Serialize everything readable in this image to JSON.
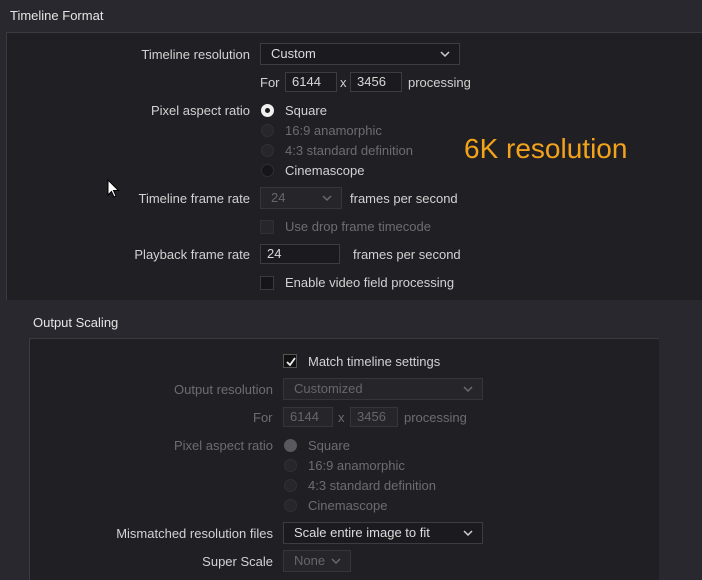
{
  "timeline_format": {
    "title": "Timeline Format",
    "resolution_label": "Timeline resolution",
    "resolution_value": "Custom",
    "for_label": "For",
    "width": "6144",
    "x_label": "x",
    "height": "3456",
    "processing_label": "processing",
    "par_label": "Pixel aspect ratio",
    "par_options": [
      "Square",
      "16:9 anamorphic",
      "4:3 standard definition",
      "Cinemascope"
    ],
    "frame_rate_label": "Timeline frame rate",
    "frame_rate_value": "24",
    "fps_label": "frames per second",
    "drop_frame_label": "Use drop frame timecode",
    "playback_label": "Playback frame rate",
    "playback_value": "24",
    "playback_fps_label": "frames per second",
    "field_processing_label": "Enable video field processing"
  },
  "annotation": {
    "text": "6K resolution",
    "color": "#f2a21b"
  },
  "output_scaling": {
    "title": "Output Scaling",
    "match_label": "Match timeline settings",
    "match_checked": true,
    "output_res_label": "Output resolution",
    "output_res_value": "Customized",
    "for_label": "For",
    "width": "6144",
    "x_label": "x",
    "height": "3456",
    "processing_label": "processing",
    "par_label": "Pixel aspect ratio",
    "par_options": [
      "Square",
      "16:9 anamorphic",
      "4:3 standard definition",
      "Cinemascope"
    ],
    "mismatch_label": "Mismatched resolution files",
    "mismatch_value": "Scale entire image to fit",
    "super_scale_label": "Super Scale",
    "super_scale_value": "None"
  }
}
